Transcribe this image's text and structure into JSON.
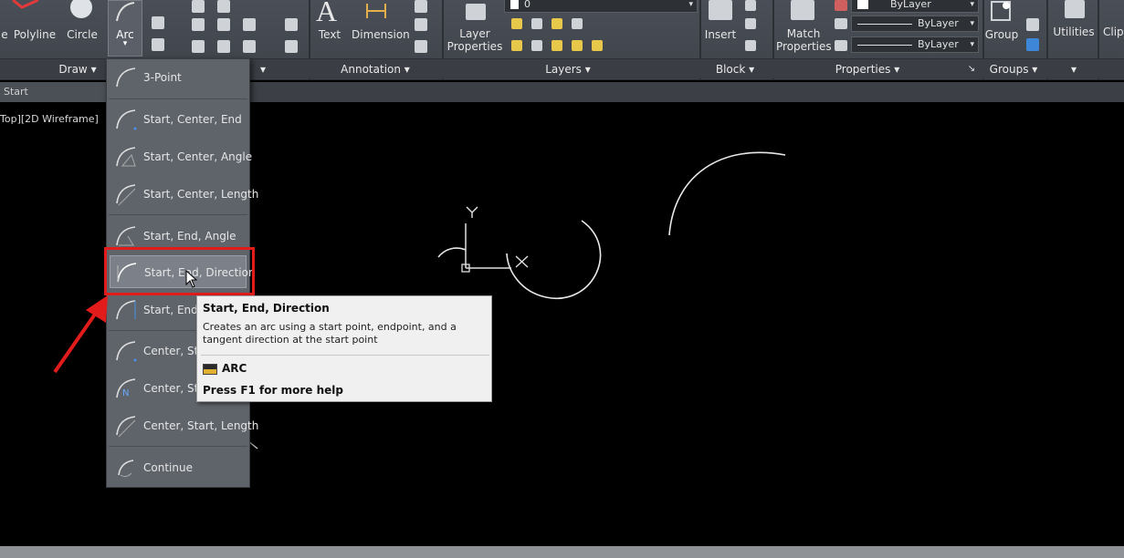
{
  "ribbon": {
    "draw_panel": {
      "title": "Draw",
      "buttons": [
        "Polyline",
        "Circle",
        "Arc"
      ]
    },
    "modify_panel_arrow": "▾",
    "annotation_panel": {
      "title": "Annotation",
      "buttons": [
        "Text",
        "Dimension"
      ]
    },
    "layers_panel": {
      "title": "Layers",
      "layer_properties": "Layer\nProperties",
      "layer_value": "0"
    },
    "block_panel": {
      "title": "Block",
      "insert": "Insert"
    },
    "properties_panel": {
      "title": "Properties",
      "match_properties": "Match\nProperties",
      "bylayer_1": "ByLayer",
      "bylayer_2": "ByLayer",
      "bylayer_3": "ByLayer"
    },
    "groups_panel": {
      "title": "Groups",
      "group": "Group"
    },
    "utilities": "Utilities",
    "clipboard": "Clip",
    "partial_left_label": "e"
  },
  "tabs": {
    "start": "Start"
  },
  "viewport": {
    "label": "Top][2D Wireframe]"
  },
  "arc_menu": {
    "items": [
      "3-Point",
      "Start, Center, End",
      "Start, Center, Angle",
      "Start, Center, Length",
      "Start, End, Angle",
      "Start, End, Direction",
      "Start, End,",
      "Center, Sta",
      "Center, Sta",
      "Center, Start, Length",
      "Continue"
    ]
  },
  "tooltip": {
    "title": "Start, End, Direction",
    "description": "Creates an arc using a start point, endpoint, and a tangent direction at the start point",
    "command": "ARC",
    "help": "Press F1 for more help"
  },
  "ucs": {
    "x": "X",
    "y": "Y"
  },
  "colors": {
    "highlight_box": "#e21b1b",
    "ribbon_bg": "#434850",
    "canvas_bg": "#000000"
  }
}
